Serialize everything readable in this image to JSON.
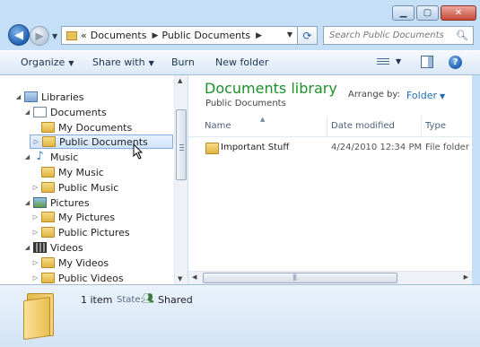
{
  "window": {
    "minimize_icon": "minimize-icon",
    "maximize_icon": "maximize-icon",
    "close_icon": "close-icon"
  },
  "nav": {
    "back_glyph": "◀",
    "forward_glyph": "▶",
    "breadcrumb": [
      "«",
      "Documents",
      "Public Documents"
    ],
    "refresh_glyph": "⟳",
    "search_placeholder": "Search Public Documents"
  },
  "toolbar": {
    "organize": "Organize",
    "share_with": "Share with",
    "burn": "Burn",
    "new_folder": "New folder",
    "help": "?"
  },
  "tree": [
    {
      "label": "Libraries",
      "icon": "library-icon"
    },
    {
      "label": "Documents",
      "icon": "documents-icon"
    },
    {
      "label": "My Documents",
      "icon": "folder-icon"
    },
    {
      "label": "Public Documents",
      "icon": "folder-icon",
      "selected": true
    },
    {
      "label": "Music",
      "icon": "music-icon"
    },
    {
      "label": "My Music",
      "icon": "folder-icon"
    },
    {
      "label": "Public Music",
      "icon": "folder-icon"
    },
    {
      "label": "Pictures",
      "icon": "pictures-icon"
    },
    {
      "label": "My Pictures",
      "icon": "folder-icon"
    },
    {
      "label": "Public Pictures",
      "icon": "folder-icon"
    },
    {
      "label": "Videos",
      "icon": "videos-icon"
    },
    {
      "label": "My Videos",
      "icon": "folder-icon"
    },
    {
      "label": "Public Videos",
      "icon": "folder-icon"
    }
  ],
  "content": {
    "title": "Documents library",
    "subtitle": "Public Documents",
    "arrange_label": "Arrange by:",
    "arrange_value": "Folder",
    "columns": [
      "Name",
      "Date modified",
      "Type"
    ],
    "rows": [
      {
        "name": "Important Stuff",
        "date": "4/24/2010 12:34 PM",
        "type": "File folder"
      }
    ]
  },
  "details": {
    "count": "1 item",
    "state_label": "State:",
    "state_value": "Shared"
  }
}
